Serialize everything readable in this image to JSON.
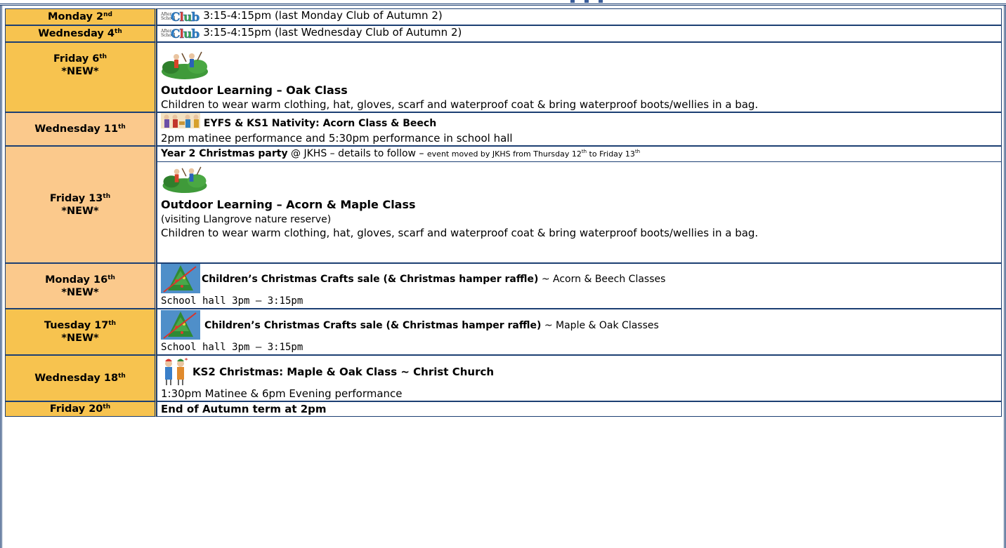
{
  "rows": [
    {
      "date": "Monday 2",
      "suffix": "nd",
      "color": "#f7c34f",
      "logo": "after-school-club",
      "text": "3:15-4:15pm  (last Monday Club of Autumn 2)"
    },
    {
      "date": "Wednesday 4",
      "suffix": "th",
      "color": "#f7c34f",
      "logo": "after-school-club",
      "text": "3:15-4:15pm  (last Wednesday Club of Autumn 2)"
    },
    {
      "date": "Friday 6",
      "suffix": "th",
      "note": "*NEW*",
      "color": "#f7c34f",
      "image": "outdoor-learning-illustration",
      "title": "Outdoor Learning – Oak Class",
      "text": "Children to wear warm clothing, hat, gloves, scarf and waterproof coat & bring waterproof boots/wellies in a bag."
    },
    {
      "date": "Wednesday 11",
      "suffix": "th",
      "color": "#fbc98c",
      "image": "nativity-illustration",
      "title": "EYFS & KS1 Nativity: Acorn Class & Beech",
      "text": "2pm matinee performance and 5:30pm performance in school hall"
    },
    {
      "date": "Friday 13",
      "suffix": "th",
      "note": "*NEW*",
      "color": "#fbc98c",
      "party_title": "Year 2 Christmas party",
      "party_text": " @ JKHS – details to follow – ",
      "party_small_a": "event moved by JKHS from Thursday 12",
      "party_small_sup": "th",
      "party_small_b": " to Friday 13",
      "party_small_sup2": "th",
      "image": "outdoor-learning-illustration",
      "title": "Outdoor Learning – Acorn & Maple Class",
      "text_a": "(visiting Llangrove nature reserve)",
      "text": "Children to wear warm clothing, hat, gloves, scarf and waterproof coat & bring waterproof boots/wellies in a bag."
    },
    {
      "date": "Monday 16",
      "suffix": "th",
      "note": "*NEW*",
      "color": "#fbc98c",
      "image": "christmas-tree-icon",
      "title": "Children’s Christmas Crafts sale (& Christmas hamper raffle)",
      "tail": " ~ Acorn & Beech Classes",
      "text": "School hall 3pm – 3:15pm"
    },
    {
      "date": "Tuesday 17",
      "suffix": "th",
      "note": "*NEW*",
      "color": "#f7c34f",
      "image": "christmas-tree-icon",
      "title": "Children’s Christmas Crafts sale (& Christmas hamper raffle)",
      "tail": " ~ Maple & Oak Classes",
      "text": "School hall 3pm – 3:15pm"
    },
    {
      "date": "Wednesday 18",
      "suffix": "th",
      "color": "#f7c34f",
      "image": "carol-singers-illustration",
      "title": "KS2 Christmas: Maple & Oak Class ~ Christ Church",
      "text": "1:30pm Matinee & 6pm Evening performance"
    },
    {
      "date": "Friday 20",
      "suffix": "th",
      "color": "#f7c34f",
      "title": "End of Autumn term at 2pm"
    }
  ],
  "logo": {
    "small_a": "After",
    "small_b": "School",
    "word_a": "C",
    "word_l": "l",
    "word_u": "u",
    "word_b": "b"
  }
}
